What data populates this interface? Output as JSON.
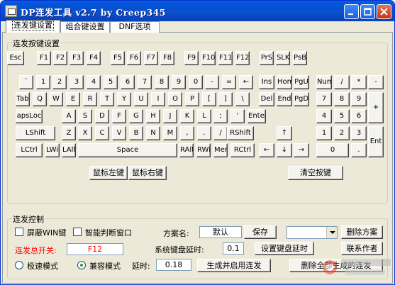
{
  "window": {
    "title": "DP连发工具 v2.7 by Creep345"
  },
  "tabs": [
    "连发键设置",
    "组合键设置",
    "DNF选项"
  ],
  "keyboard_group": {
    "label": "连发按键设置"
  },
  "keys": {
    "esc": "Esc",
    "f1": "F1",
    "f2": "F2",
    "f3": "F3",
    "f4": "F4",
    "f5": "F5",
    "f6": "F6",
    "f7": "F7",
    "f8": "F8",
    "f9": "F9",
    "f10": "F10",
    "f11": "F11",
    "f12": "F12",
    "prs": "PrS",
    "slk": "SLK",
    "psb": "PsB",
    "backtick": "`",
    "n1": "1",
    "n2": "2",
    "n3": "3",
    "n4": "4",
    "n5": "5",
    "n6": "6",
    "n7": "7",
    "n8": "8",
    "n9": "9",
    "n0": "0",
    "minus": "-",
    "equals": "=",
    "backspace": "←",
    "tab": "Tab",
    "q": "Q",
    "w": "W",
    "e": "E",
    "r": "R",
    "t": "T",
    "y": "Y",
    "u": "U",
    "i": "I",
    "o": "O",
    "p": "P",
    "lbracket": "[",
    "rbracket": "]",
    "backslash": "\\",
    "capslock": "apsLoc",
    "a": "A",
    "s": "S",
    "d": "D",
    "f": "F",
    "g": "G",
    "h": "H",
    "j": "J",
    "k": "K",
    "l": "L",
    "semicolon": ";",
    "quote": "'",
    "enter": "Enter",
    "lshift": "LShift",
    "z": "Z",
    "x": "X",
    "c": "C",
    "v": "V",
    "b": "B",
    "n": "N",
    "m": "M",
    "comma": ",",
    "period": ".",
    "slash": "/",
    "rshift": "RShift",
    "lctrl": "LCtrl",
    "lwin": "LWin",
    "lalt": "LAlt",
    "space": "Space",
    "ralt": "RAlt",
    "rwin": "RWin",
    "menu": "Menu",
    "rctrl": "RCtrl",
    "ins": "Ins",
    "home": "Hom",
    "pgup": "PgU",
    "del": "Del",
    "end": "End",
    "pgdn": "PgD",
    "up": "↑",
    "left": "←",
    "down": "↓",
    "right": "→",
    "numlock": "Num",
    "np_div": "/",
    "np_mul": "*",
    "np_sub": "-",
    "np7": "7",
    "np8": "8",
    "np9": "9",
    "np_add": "+",
    "np4": "4",
    "np5": "5",
    "np6": "6",
    "np1": "1",
    "np2": "2",
    "np3": "3",
    "np_enter": "Ent",
    "np0": "0",
    "np_dot": "."
  },
  "mouse_buttons": {
    "left": "鼠标左键",
    "right": "鼠标右键"
  },
  "clear_button": "清空按键",
  "control_group": {
    "label": "连发控制",
    "block_win_label": "屏蔽WIN键",
    "smart_window_label": "智能判断窗口",
    "master_switch_label": "连发总开关:",
    "master_switch_value": "F12",
    "mode_fast_label": "极速模式",
    "mode_compat_label": "兼容模式",
    "mode_selected": "兼容模式",
    "delay_label": "延时:",
    "delay_value": "0.18",
    "scheme_label": "方案名:",
    "scheme_value": "默认",
    "save_button": "保存",
    "kbd_delay_label": "系统键盘延时:",
    "kbd_delay_value": "0.1",
    "set_kbd_delay_button": "设置键盘延时",
    "generate_button": "生成并启用连发",
    "delete_scheme_button": "删除方案",
    "contact_button": "联系作者",
    "delete_generated_button": "删除全部生成的连发",
    "scheme_select_value": ""
  },
  "colors": {
    "title_bar": "#0a4fcb",
    "master_switch": "#ff0000"
  }
}
